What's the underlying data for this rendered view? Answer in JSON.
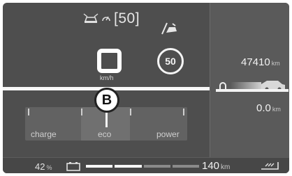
{
  "cruise": {
    "set_speed": "[50]"
  },
  "speed": {
    "unit": "km/h"
  },
  "speed_limit": {
    "value": "50"
  },
  "marker": {
    "label": "B"
  },
  "power_meter": {
    "zones": [
      "charge",
      "eco",
      "power"
    ],
    "needle_position": "eco"
  },
  "odometer": {
    "value": "47410",
    "unit": "km"
  },
  "trip": {
    "value": "0.0",
    "unit": "km"
  },
  "battery": {
    "percent": "42",
    "percent_unit": "%"
  },
  "range": {
    "value": "140",
    "unit": "km",
    "gauge_segments_total": 4,
    "gauge_segments_lit": 2
  },
  "icons": [
    "adaptive-cruise-car-icon",
    "cruise-control-icon",
    "lane-assist-icon",
    "reset-trip-icon",
    "car-silhouette-icon",
    "battery-icon",
    "ev-mode-icon"
  ],
  "colors": {
    "screen_bg": "#4e4e4e",
    "panel_bg": "#5a5a5a",
    "foreground": "#f4f4f4"
  }
}
